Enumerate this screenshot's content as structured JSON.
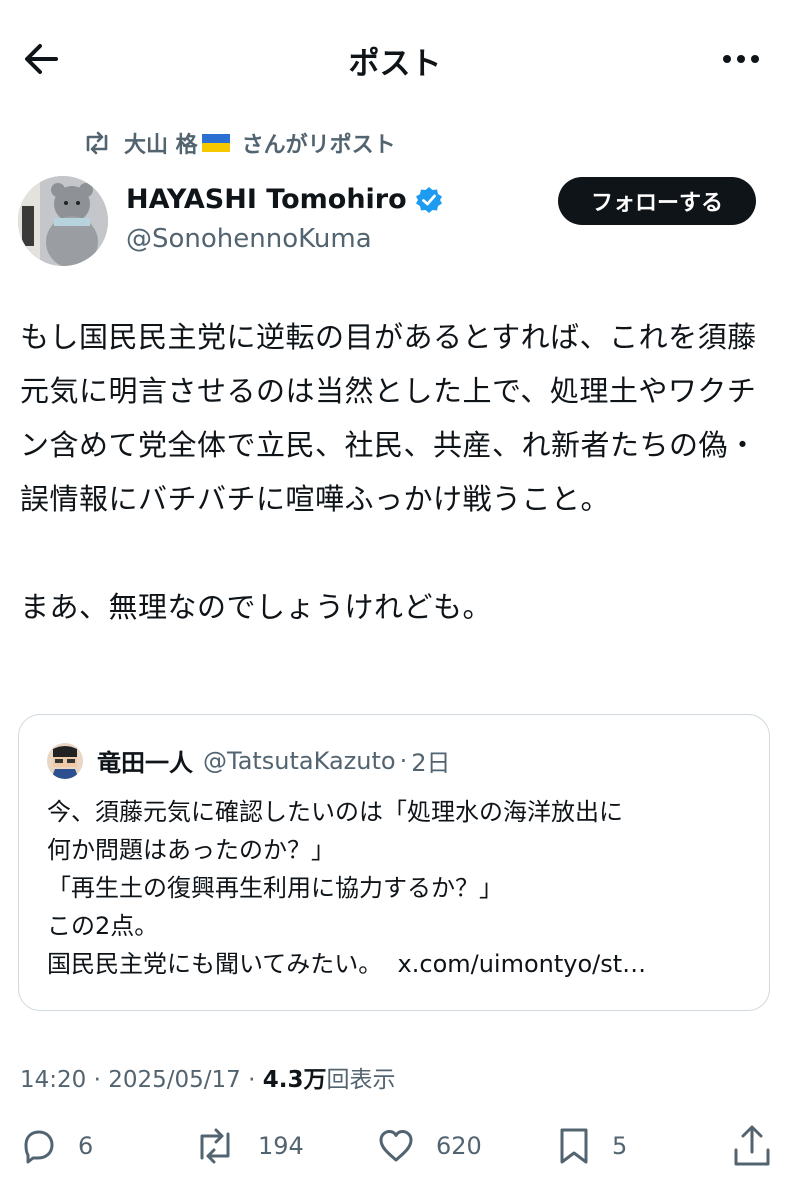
{
  "header": {
    "title": "ポスト",
    "back_icon": "arrow-left-icon",
    "more_icon": "more-horizontal-icon"
  },
  "repost": {
    "icon": "repost-icon",
    "user": "大山 格",
    "flag": "ukraine-flag-icon",
    "suffix": "さんがリポスト"
  },
  "author": {
    "name": "HAYASHI Tomohiro",
    "handle": "@SonohennoKuma",
    "verified_icon": "verified-badge-icon",
    "follow_label": "フォローする"
  },
  "tweet": {
    "text": "もし国民民主党に逆転の目があるとすれば、これを須藤元気に明言させるのは当然とした上で、処理土やワクチン含めて党全体で立民、社民、共産、れ新者たちの偽・誤情報にバチバチに喧嘩ふっかけ戦うこと。\n\nまあ、無理なのでしょうけれども。"
  },
  "quote": {
    "name": "竜田一人",
    "handle": "@TatsutaKazuto",
    "separator": "·",
    "time": "2日",
    "line1": "今、須藤元気に確認したいのは「処理水の海洋放出に",
    "line2": "何か問題はあったのか？」",
    "line3": "「再生土の復興再生利用に協力するか？」",
    "line4": "この2点。",
    "line5_text": "国民民主党にも聞いてみたい。",
    "line5_link": "x.com/uimontyo/st…"
  },
  "meta": {
    "time": "14:20",
    "sep1": "·",
    "date": "2025/05/17",
    "sep2": "·",
    "views_count": "4.3万",
    "views_label": "回表示"
  },
  "actions": {
    "replies": "6",
    "reposts": "194",
    "likes": "620",
    "bookmarks": "5",
    "reply_icon": "reply-icon",
    "repost_icon": "repost-icon",
    "like_icon": "heart-icon",
    "bookmark_icon": "bookmark-icon",
    "share_icon": "share-icon"
  },
  "colors": {
    "text": "#0f1419",
    "secondary": "#536471",
    "verified": "#1d9bf0",
    "border": "#cfd9de"
  }
}
